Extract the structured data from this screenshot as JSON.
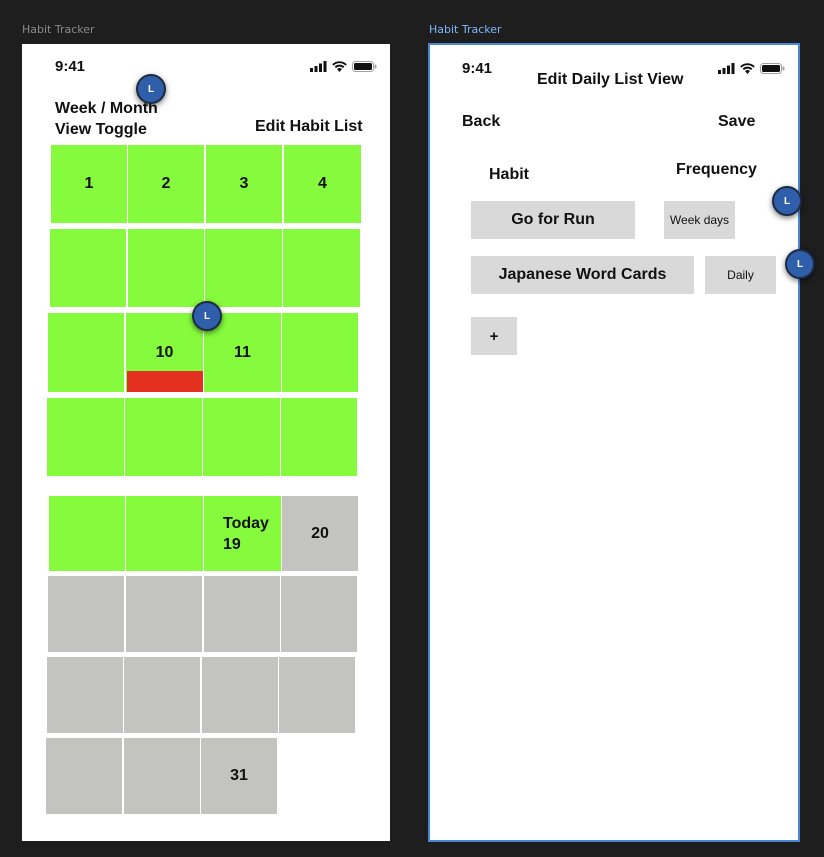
{
  "frames": [
    {
      "label": "Habit Tracker"
    },
    {
      "label": "Habit Tracker"
    }
  ],
  "status": {
    "time": "9:41"
  },
  "calendar": {
    "toggle_label_line1": "Week / Month",
    "toggle_label_line2": "View Toggle",
    "edit_link": "Edit Habit List",
    "day_1": "1",
    "day_2": "2",
    "day_3": "3",
    "day_4": "4",
    "day_10": "10",
    "day_11": "11",
    "today_label": "Today",
    "today_number": "19",
    "day_20": "20",
    "day_31": "31"
  },
  "edit_view": {
    "title": "Edit Daily List View",
    "back": "Back",
    "save": "Save",
    "col_habit": "Habit",
    "col_frequency": "Frequency",
    "habits": [
      {
        "name": "Go for Run",
        "frequency": "Week days"
      },
      {
        "name": "Japanese Word Cards",
        "frequency": "Daily"
      }
    ],
    "add_label": "+"
  },
  "avatar_initial": "L",
  "colors": {
    "canvas": "#1e1e1e",
    "done": "#86fb3d",
    "future": "#c3c4bf",
    "missed": "#e3301f",
    "selection": "#4a86d6",
    "button": "#d9d9d9"
  },
  "icons": [
    "signal-icon",
    "wifi-icon",
    "battery-icon"
  ]
}
